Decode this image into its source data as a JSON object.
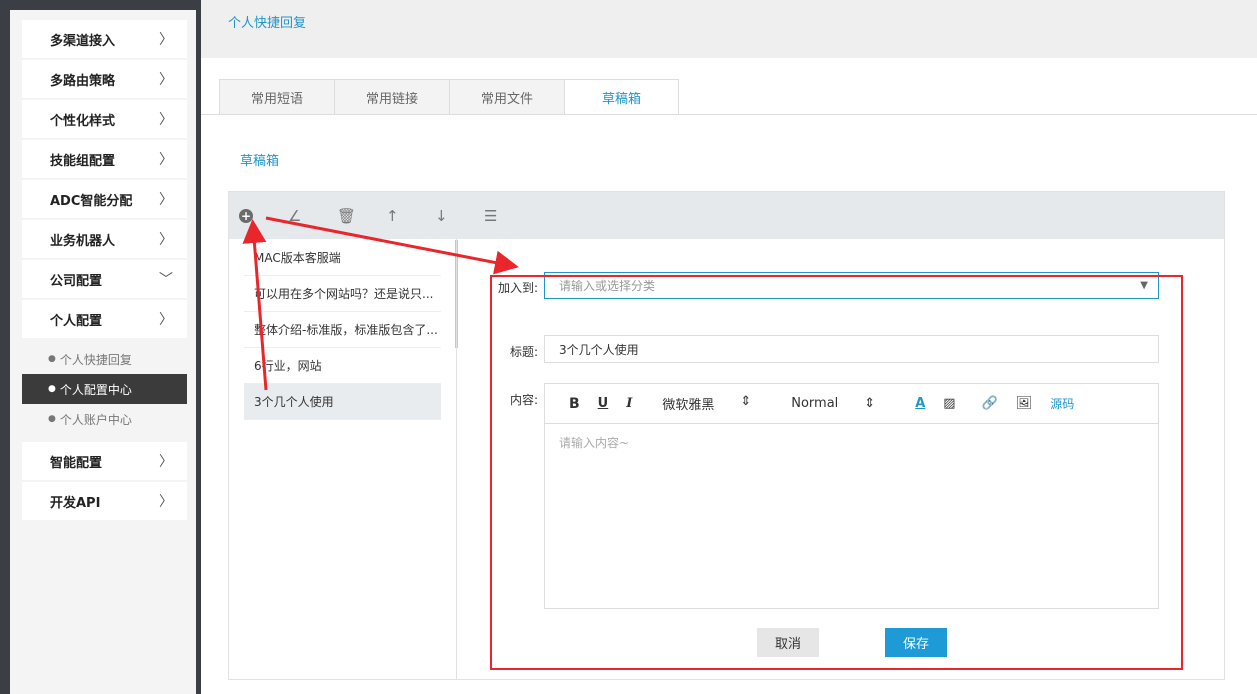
{
  "sidebar": {
    "items": [
      {
        "label": "多渠道接入",
        "chevron": "right"
      },
      {
        "label": "多路由策略",
        "chevron": "right"
      },
      {
        "label": "个性化样式",
        "chevron": "right"
      },
      {
        "label": "技能组配置",
        "chevron": "right"
      },
      {
        "label": "ADC智能分配",
        "chevron": "right"
      },
      {
        "label": "业务机器人",
        "chevron": "right"
      },
      {
        "label": "公司配置",
        "chevron": "down"
      },
      {
        "label": "个人配置",
        "chevron": "right"
      }
    ],
    "submenu": [
      "个人快捷回复",
      "个人配置中心",
      "个人账户中心"
    ],
    "items_after": [
      {
        "label": "智能配置",
        "chevron": "right"
      },
      {
        "label": "开发API",
        "chevron": "right"
      }
    ]
  },
  "breadcrumb": "个人快捷回复",
  "tabs": [
    "常用短语",
    "常用链接",
    "常用文件",
    "草稿箱"
  ],
  "section_title": "草稿箱",
  "toolbar_icons": [
    "add-icon",
    "edit-icon",
    "delete-icon",
    "move-up-icon",
    "move-down-icon",
    "list-icon"
  ],
  "draft_list": [
    "MAC版本客服端",
    "可以用在多个网站吗？还是说只...",
    "整体介绍-标准版，标准版包含了...",
    "6行业，网站",
    "3个几个人使用"
  ],
  "form": {
    "add_to_label": "加入到:",
    "add_to_placeholder": "请输入或选择分类",
    "title_label": "标题:",
    "title_value": "3个几个人使用",
    "content_label": "内容:",
    "font_name": "微软雅黑",
    "font_size": "Normal",
    "bold": "B",
    "underline": "U",
    "italic": "I",
    "text_color": "A",
    "source": "源码",
    "content_placeholder": "请输入内容~",
    "cancel": "取消",
    "save": "保存"
  },
  "colors": {
    "accent": "#2196c8",
    "save": "#1e9ad6",
    "annotation": "#e8262b"
  }
}
